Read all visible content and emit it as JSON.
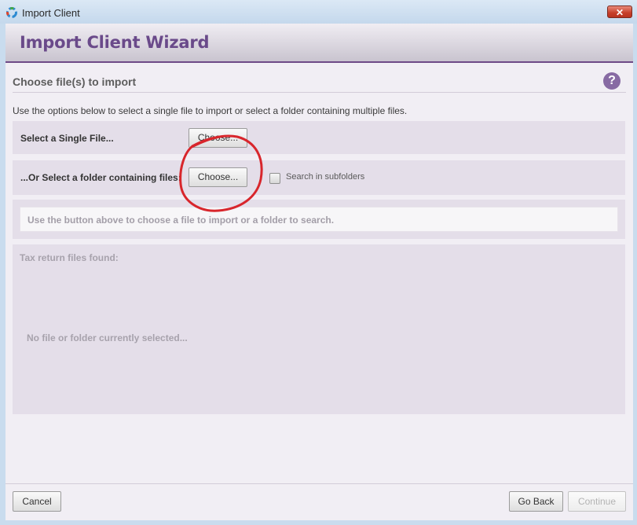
{
  "window": {
    "title": "Import Client",
    "close_glyph": "✕"
  },
  "header": {
    "title": "Import Client Wizard"
  },
  "section": {
    "title": "Choose file(s) to import",
    "help_glyph": "?"
  },
  "instructions": "Use the options below to select a single file to import or select a folder containing multiple files.",
  "single_file": {
    "label": "Select a Single File...",
    "button_label": "Choose..."
  },
  "folder": {
    "label": "...Or Select a folder containing files:",
    "button_label": "Choose...",
    "subfolders_label": "Search in subfolders",
    "subfolders_checked": false
  },
  "status_message": "Use the button above to choose a file to import or a folder to search.",
  "files_panel": {
    "title": "Tax return files found:",
    "empty_message": "No file or folder currently selected..."
  },
  "footer": {
    "cancel_label": "Cancel",
    "go_back_label": "Go Back",
    "continue_label": "Continue"
  },
  "colors": {
    "brand_purple": "#6a4a8a",
    "panel_bg": "#e4dee9",
    "annotation_red": "#d8262c"
  },
  "icons": {
    "app": "app-ring-icon",
    "help": "help-icon",
    "close": "close-icon"
  }
}
